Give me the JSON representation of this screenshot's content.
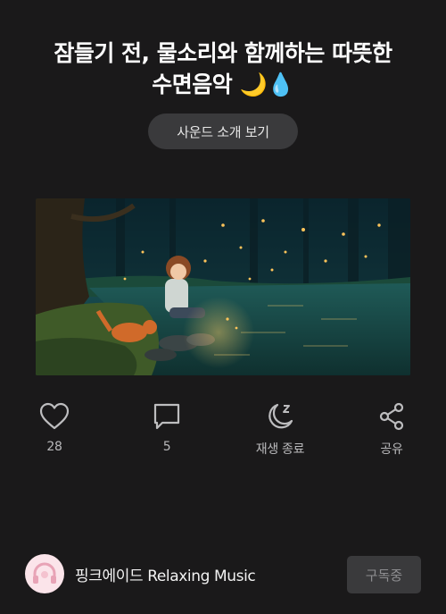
{
  "video": {
    "title_line1": "잠들기 전, 물소리와 함께하는 따뜻한",
    "title_line2": "수면음악 🌙💧",
    "sound_intro_label": "사운드 소개 보기"
  },
  "actions": {
    "like_count": "28",
    "comment_count": "5",
    "sleep_timer_label": "재생 종료",
    "share_label": "공유"
  },
  "channel": {
    "name": "핑크에이드 Relaxing Music",
    "subscribe_label": "구독중"
  },
  "colors": {
    "background": "#1a191a",
    "pill": "#3a3a3c",
    "icon": "#bdbdbf"
  }
}
